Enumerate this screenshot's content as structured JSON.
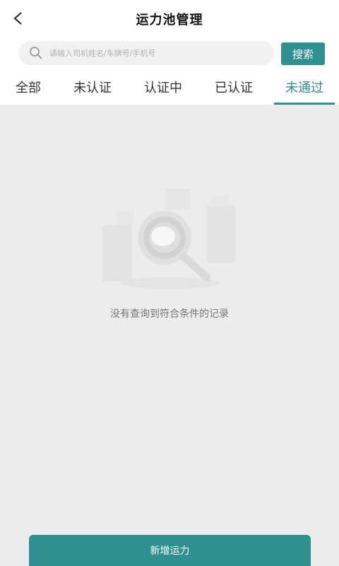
{
  "header": {
    "title": "运力池管理",
    "back_icon": "chevron-left-icon"
  },
  "search": {
    "placeholder": "请输入司机姓名/车牌号/手机号",
    "button_label": "搜索",
    "icon": "search-icon"
  },
  "tabs": [
    {
      "label": "全部",
      "active": false
    },
    {
      "label": "未认证",
      "active": false
    },
    {
      "label": "认证中",
      "active": false
    },
    {
      "label": "已认证",
      "active": false
    },
    {
      "label": "未通过",
      "active": true
    }
  ],
  "empty_state": {
    "message": "没有查询到符合条件的记录",
    "illustration": "empty-search-illustration"
  },
  "footer": {
    "add_button_label": "新增运力"
  },
  "colors": {
    "accent": "#2f8f91",
    "background": "#ececec",
    "header_bg": "#ffffff"
  }
}
